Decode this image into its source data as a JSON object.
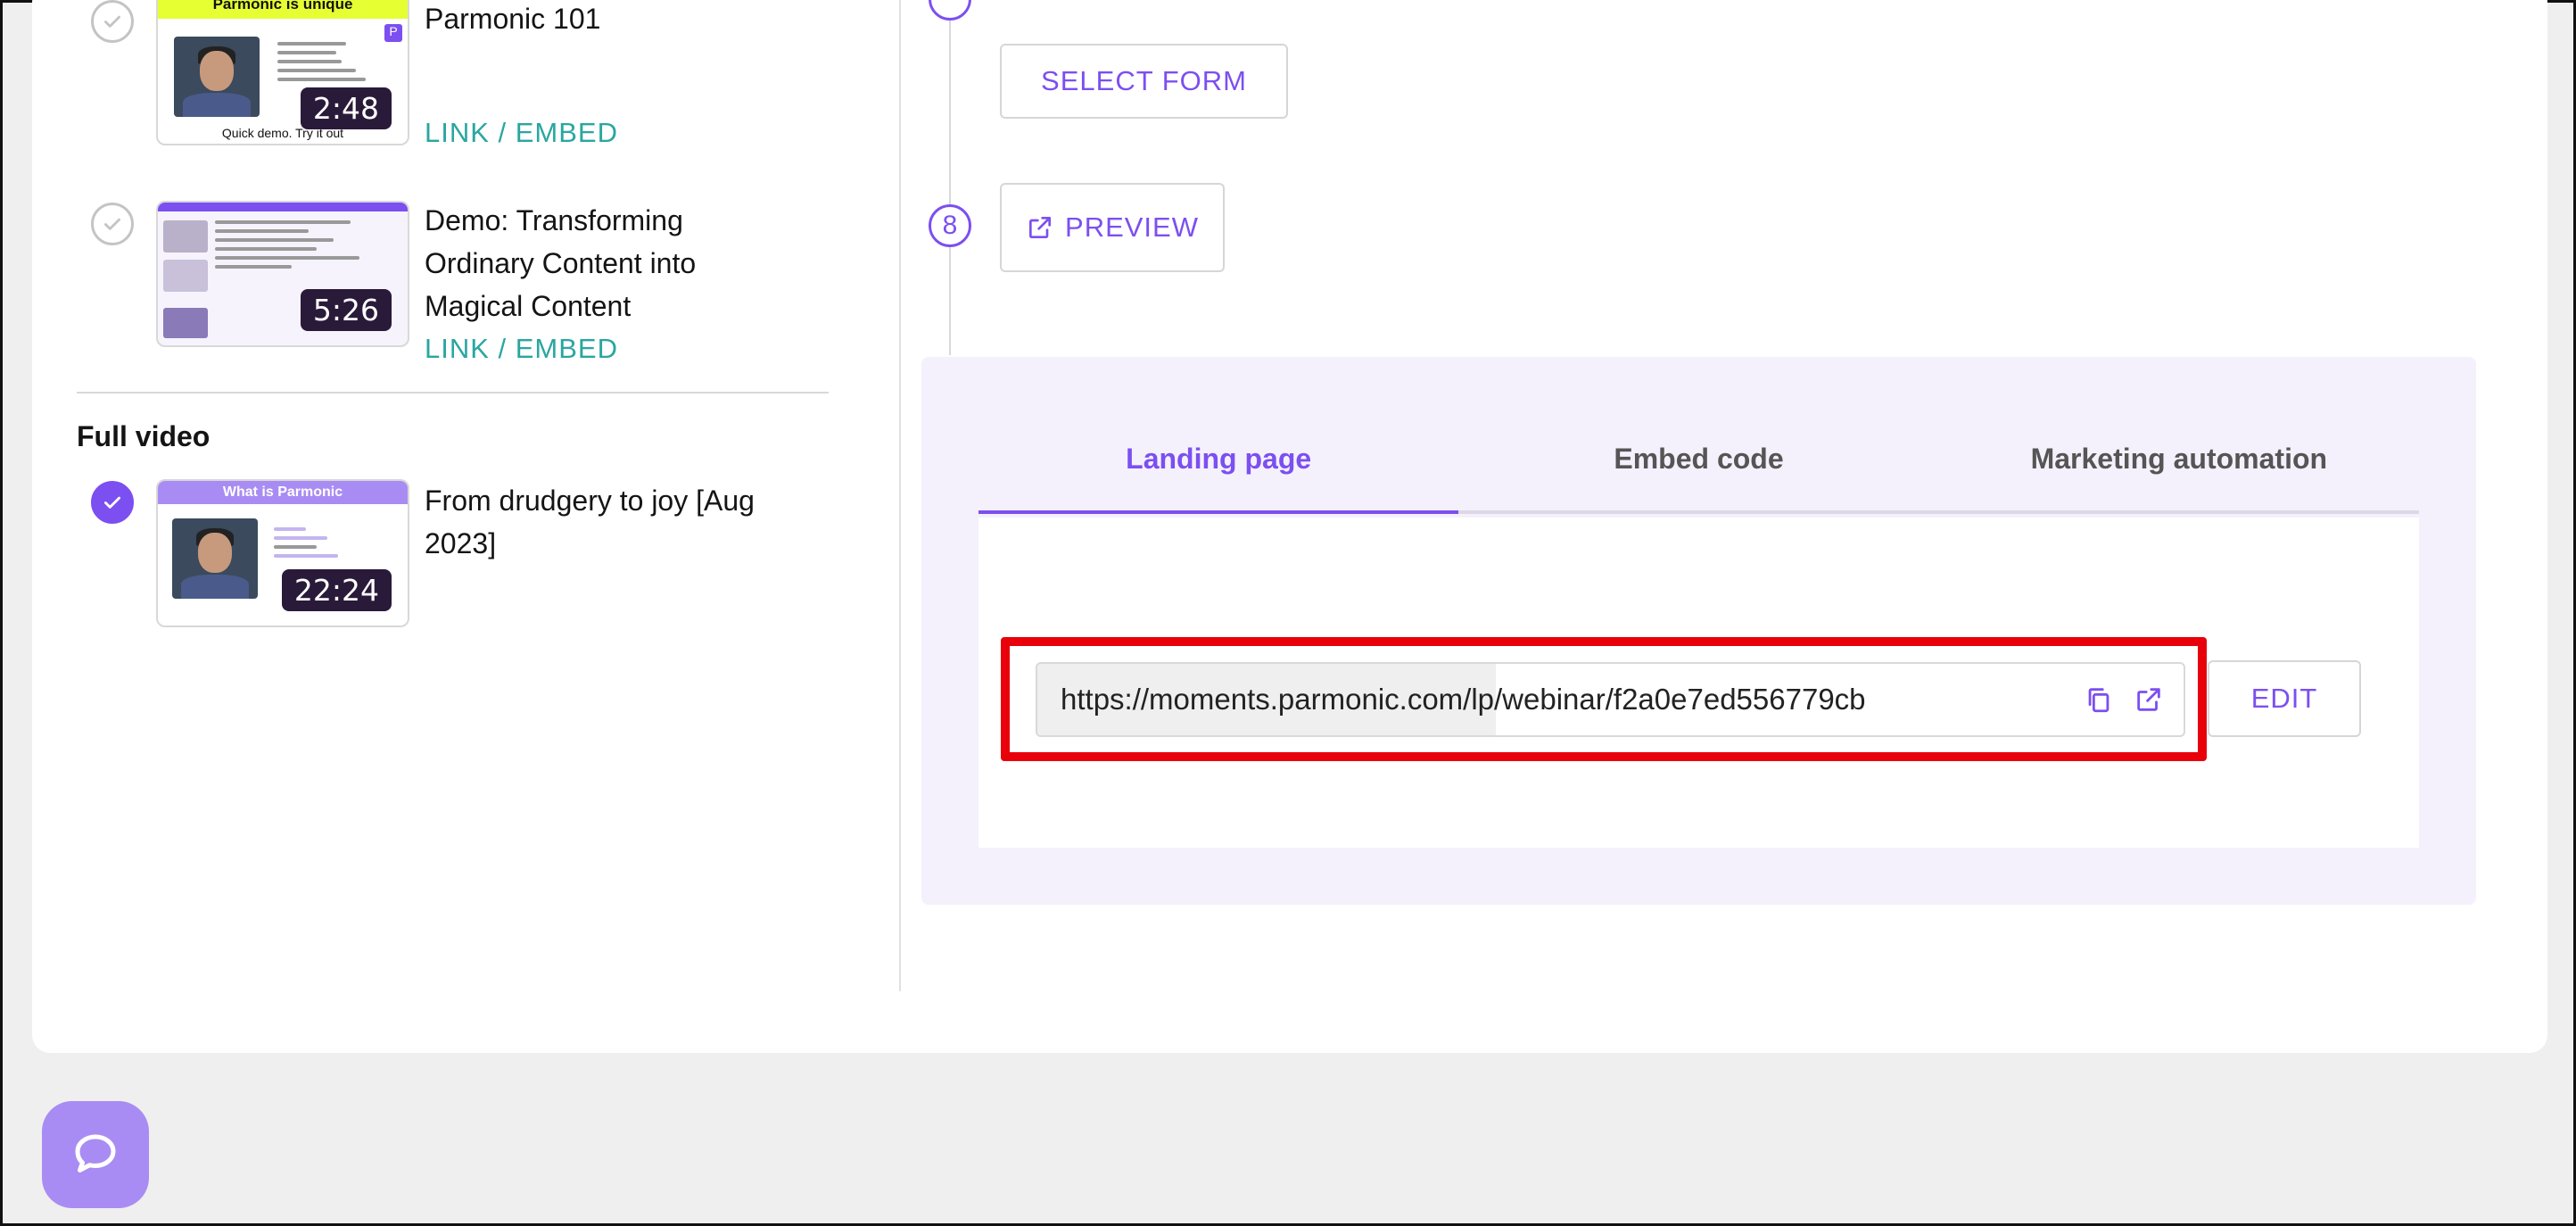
{
  "videos": [
    {
      "title": "Parmonic 101",
      "duration": "2:48",
      "link": "LINK / EMBED",
      "thumb_header": "Parmonic is unique",
      "thumb_caption": "Quick demo. Try it out",
      "selected": false
    },
    {
      "title": "Demo: Transforming Ordinary Content into Magical Content",
      "duration": "5:26",
      "link": "LINK / EMBED",
      "selected": false
    }
  ],
  "full_video": {
    "section_label": "Full video",
    "title": "From drudgery to joy [Aug 2023]",
    "duration": "22:24",
    "thumb_header": "What is Parmonic",
    "selected": true
  },
  "steps": {
    "select_form_label": "SELECT FORM",
    "preview_step_number": "8",
    "preview_label": "PREVIEW"
  },
  "tabs": [
    {
      "label": "Landing page",
      "active": true
    },
    {
      "label": "Embed code",
      "active": false
    },
    {
      "label": "Marketing automation",
      "active": false
    }
  ],
  "landing_page": {
    "url": "https://moments.parmonic.com/lp/webinar/f2a0e7ed556779cb",
    "edit_label": "EDIT",
    "copy_icon": "copy-icon",
    "open_icon": "external-link-icon"
  },
  "colors": {
    "accent": "#7c4ff0",
    "link_teal": "#2aa6a0",
    "highlight_red": "#e8000b",
    "panel_bg": "#f4f1fd",
    "chat_button": "#a98cf3"
  },
  "chat_icon": "chat-bubble-icon"
}
